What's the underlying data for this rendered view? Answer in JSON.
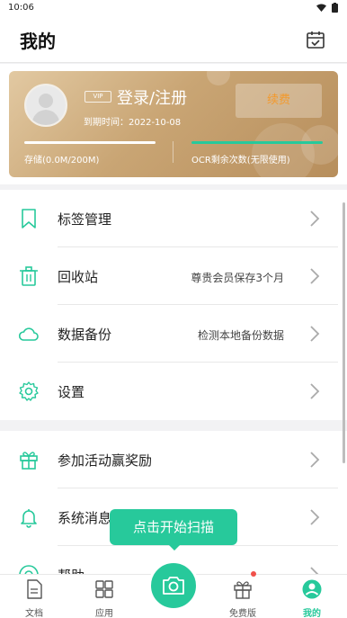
{
  "status_bar": {
    "time": "10:06"
  },
  "header": {
    "title": "我的",
    "calendar_icon": "calendar-check-icon"
  },
  "vip_card": {
    "badge": "VIP",
    "login_text": "登录/注册",
    "expire_text": "到期时间：2022-10-08",
    "renew_label": "续费",
    "storage_text": "存储(0.0M/200M)",
    "ocr_text": "OCR剩余次数(无限使用)",
    "colors": {
      "gold_light": "#e2c9a2",
      "gold_dark": "#b78e5c",
      "renew_text": "#f29a2e",
      "ocr_bar": "#27c99b"
    }
  },
  "menu_group_1": [
    {
      "label": "标签管理",
      "sub": "",
      "icon": "bookmark-icon"
    },
    {
      "label": "回收站",
      "sub": "尊贵会员保存3个月",
      "icon": "trash-icon"
    },
    {
      "label": "数据备份",
      "sub": "检测本地备份数据",
      "icon": "cloud-icon"
    },
    {
      "label": "设置",
      "sub": "",
      "icon": "gear-icon"
    }
  ],
  "menu_group_2": [
    {
      "label": "参加活动赢奖励",
      "sub": "",
      "icon": "gift-icon"
    },
    {
      "label": "系统消息",
      "sub": "",
      "icon": "bell-icon"
    },
    {
      "label": "帮助",
      "sub": "",
      "icon": "help-icon"
    }
  ],
  "scan_tooltip": "点击开始扫描",
  "tabbar": {
    "tabs": [
      {
        "label": "文档",
        "icon": "document-icon"
      },
      {
        "label": "应用",
        "icon": "grid-icon"
      },
      {
        "label": "免费版",
        "icon": "gift-icon"
      },
      {
        "label": "我的",
        "icon": "profile-icon"
      }
    ],
    "scan_icon": "camera-icon",
    "accent": "#27c99b"
  }
}
